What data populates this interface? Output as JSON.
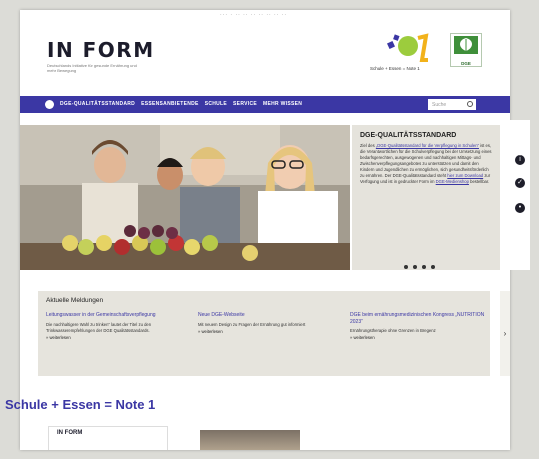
{
  "top_strip": "··· · ·· ·· ·· ·· ·· ·· ··",
  "logo": {
    "main": "IN FORM",
    "sub": "Deutschlands Initiative für gesunde Ernährung und mehr Bewegung"
  },
  "partner_logo_text": "Schule + Essen = Note 1",
  "dge_logo_text": "DGE",
  "nav": {
    "items": [
      "DGE-QUALITÄTSSTANDARD",
      "ESSENSANBIETENDE",
      "SCHULE",
      "SERVICE",
      "MEHR WISSEN"
    ],
    "search_placeholder": "Suche"
  },
  "panel": {
    "title": "DGE-QUALITÄTSSTANDARD",
    "p1": "Ziel des",
    "link1": "„DGE-Qualitätsstandard für die Verpflegung in Schulen“",
    "p2": "ist es, die Verantwortlichen für die Schulverpflegung bei der Umsetzung eines bedarfsgerechten, ausgewogenen und nachhaltigen Mittags- und Zwischenverpflegungsangebotes zu unterstützen und damit den Kindern und Jugendlichen zu ermöglichen, sich gesundheitsförderlich zu ernähren. Der DGE-Qualitätsstandard steht",
    "link2": "hier zum Download",
    "p3": "zur Verfügung und ist in gedruckter Form im",
    "link3": "DGE-Medienshop",
    "p4": "bestellbar."
  },
  "news": {
    "title": "Aktuelle Meldungen",
    "items": [
      {
        "headline": "Leitungswasser in der Gemeinschaftsverpflegung",
        "body": "Die nachhaltigere Wahl zu trinken“ lautet der Titel zu den Trinkwasserempfehlungen der DGE Qualitätsstandards.",
        "more": "» weiterlesen"
      },
      {
        "headline": "Neue DGE-Webseite",
        "body": "Mit neuem Design zu Fragen der Ernährung gut informiert",
        "more": "» weiterlesen"
      },
      {
        "headline": "DGE beim ernährungsmedizinischen Kongress „NUTRITION 2023“",
        "body": "Ernährungstherapie ohne Grenzen in Bregenz",
        "more": "» weiterlesen"
      }
    ]
  },
  "footer_title": "Schule + Essen = Note 1",
  "mini_logo": "IN FORM",
  "colors": {
    "brand_blue": "#3b37a4",
    "accent_green": "#6fa53a",
    "panel_bg": "#e5e3dc"
  }
}
